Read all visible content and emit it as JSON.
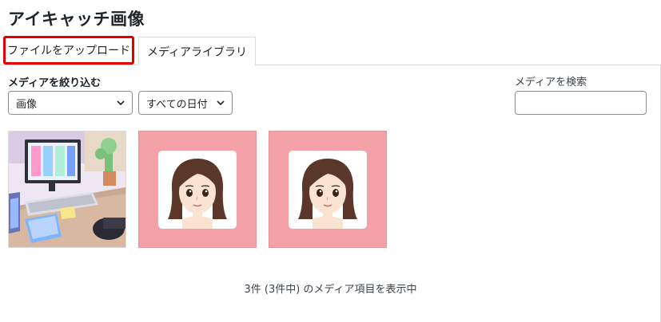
{
  "modal": {
    "title": "アイキャッチ画像"
  },
  "tabs": [
    {
      "label": "ファイルをアップロード"
    },
    {
      "label": "メディアライブラリ"
    }
  ],
  "filters": {
    "label": "メディアを絞り込む",
    "type_select": "画像",
    "date_select": "すべての日付"
  },
  "search": {
    "label": "メディアを検索",
    "value": ""
  },
  "media_items": [
    {
      "kind": "desk-illustration"
    },
    {
      "kind": "avatar-illustration"
    },
    {
      "kind": "avatar-illustration"
    }
  ],
  "status": {
    "count_text": "3件 (3件中) のメディア項目を表示中"
  },
  "colors": {
    "highlight": "#e00000",
    "thumb_pink": "#f4a0a7"
  }
}
